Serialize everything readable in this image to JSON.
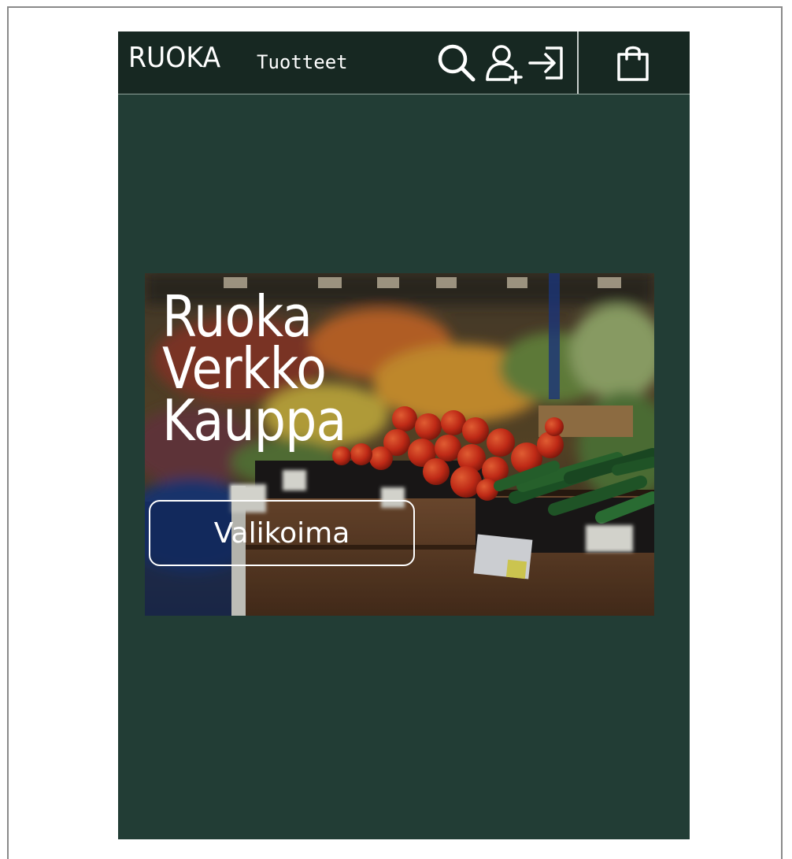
{
  "header": {
    "brand": "RUOKA",
    "nav_link": "Tuotteet",
    "icons": [
      "search-icon",
      "add-user-icon",
      "login-icon",
      "shopping-bag-icon"
    ]
  },
  "hero": {
    "title_lines": [
      "Ruoka",
      "Verkko",
      "Kauppa"
    ],
    "button_label": "Valikoima"
  },
  "colors": {
    "page_background": "#223d35",
    "navbar_background": "#172822",
    "text": "#ffffff"
  }
}
